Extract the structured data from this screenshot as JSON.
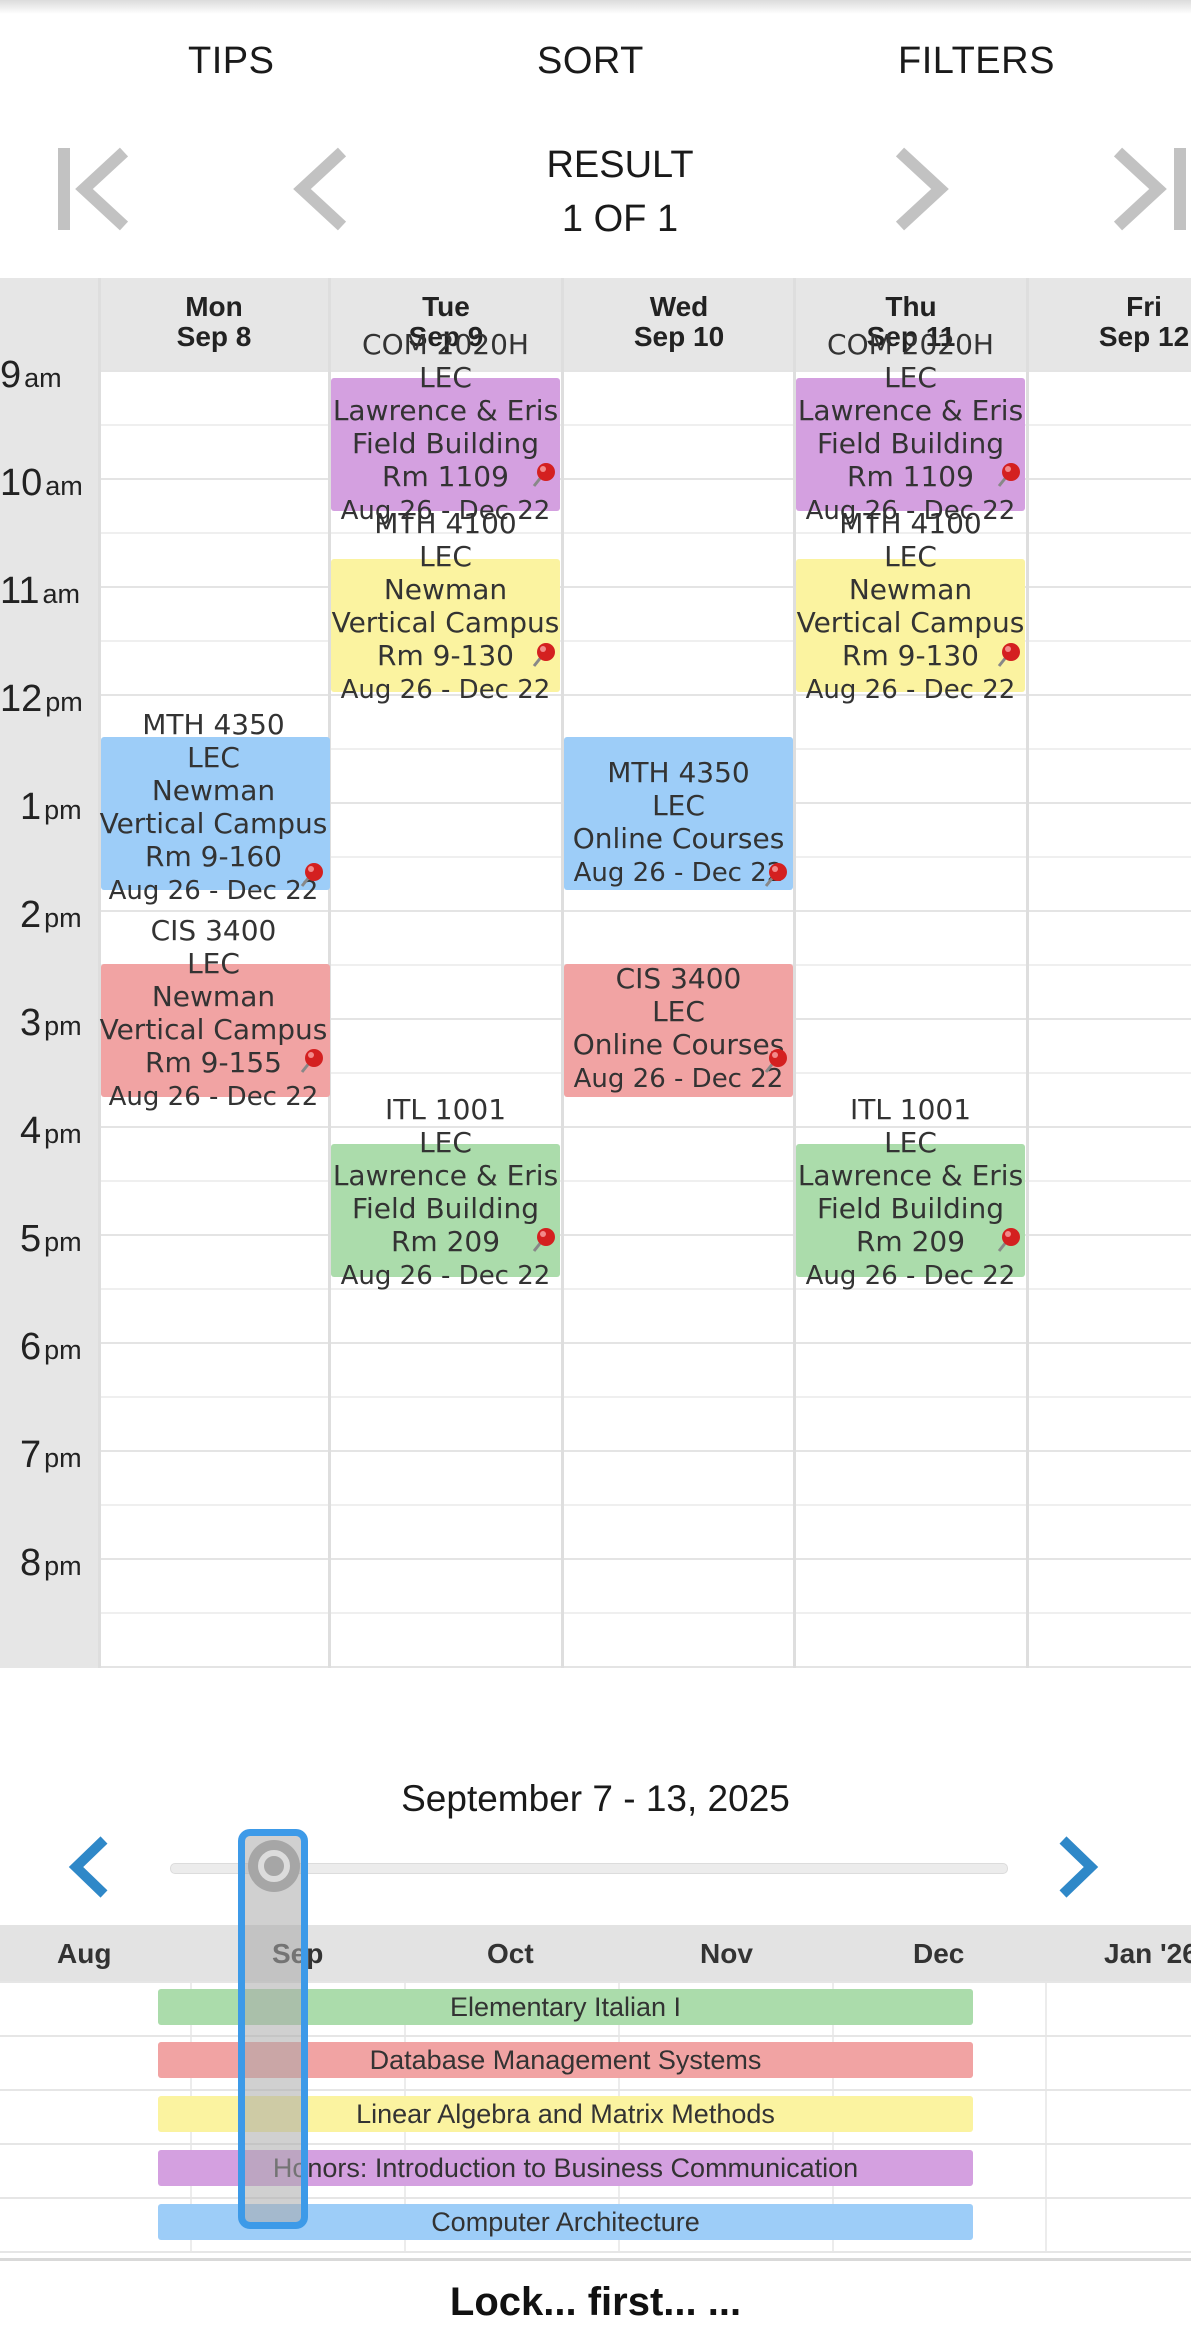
{
  "toolbar": {
    "tips": "TIPS",
    "sort": "SORT",
    "filters": "FILTERS"
  },
  "pager": {
    "line1": "RESULT",
    "line2": "1 OF 1"
  },
  "calendar": {
    "days": [
      {
        "dow": "Mon",
        "date": "Sep 8"
      },
      {
        "dow": "Tue",
        "date": "Sep 9"
      },
      {
        "dow": "Wed",
        "date": "Sep 10"
      },
      {
        "dow": "Thu",
        "date": "Sep 11"
      },
      {
        "dow": "Fri",
        "date": "Sep 12"
      }
    ],
    "times": [
      {
        "h": "9",
        "ampm": "am"
      },
      {
        "h": "10",
        "ampm": "am"
      },
      {
        "h": "11",
        "ampm": "am"
      },
      {
        "h": "12",
        "ampm": "pm"
      },
      {
        "h": "1",
        "ampm": "pm"
      },
      {
        "h": "2",
        "ampm": "pm"
      },
      {
        "h": "3",
        "ampm": "pm"
      },
      {
        "h": "4",
        "ampm": "pm"
      },
      {
        "h": "5",
        "ampm": "pm"
      },
      {
        "h": "6",
        "ampm": "pm"
      },
      {
        "h": "7",
        "ampm": "pm"
      },
      {
        "h": "8",
        "ampm": "pm"
      }
    ],
    "events": [
      {
        "title": "COM 2020H",
        "type": "LEC",
        "room": "Lawrence & Eris Field Building Rm 1109",
        "dates": "Aug 26 - Dec 22",
        "color": "#d4a0e0"
      },
      {
        "title": "MTH 4100",
        "type": "LEC",
        "room": "Newman Vertical Campus Rm 9-130",
        "dates": "Aug 26 - Dec 22",
        "color": "#fbf3a0"
      },
      {
        "title": "MTH 4350",
        "type": "LEC",
        "room": "Newman Vertical Campus Rm 9-160",
        "dates": "Aug 26 - Dec 22",
        "color": "#9dcdf8"
      },
      {
        "title": "MTH 4350",
        "type": "LEC",
        "room": "Online Courses",
        "dates": "Aug 26 - Dec 22",
        "color": "#9dcdf8"
      },
      {
        "title": "CIS 3400",
        "type": "LEC",
        "room": "Newman Vertical Campus Rm 9-155",
        "dates": "Aug 26 - Dec 22",
        "color": "#f1a3a3"
      },
      {
        "title": "CIS 3400",
        "type": "LEC",
        "room": "Online Courses",
        "dates": "Aug 26 - Dec 22",
        "color": "#f1a3a3"
      },
      {
        "title": "ITL 1001",
        "type": "LEC",
        "room": "Lawrence & Eris Field Building Rm 209",
        "dates": "Aug 26 - Dec 22",
        "color": "#abdcab"
      }
    ]
  },
  "timeline": {
    "range": "September 7 - 13, 2025",
    "months": [
      "Aug",
      "Sep",
      "Oct",
      "Nov",
      "Dec",
      "Jan '26"
    ],
    "courses": [
      {
        "name": "Elementary Italian I",
        "color": "#abdcab"
      },
      {
        "name": "Database Management Systems",
        "color": "#f1a3a3"
      },
      {
        "name": "Linear Algebra and Matrix Methods",
        "color": "#fbf3a0"
      },
      {
        "name": "Honors: Introduction to Business Communication",
        "color": "#d4a0e0"
      },
      {
        "name": "Computer Architecture",
        "color": "#9dcdf8"
      }
    ]
  },
  "footer": {
    "text": "Lock... first... ..."
  },
  "icons": [
    "first-page-icon",
    "previous-page-icon",
    "next-page-icon",
    "last-page-icon",
    "week-back-icon",
    "week-forward-icon",
    "pin-icon"
  ]
}
